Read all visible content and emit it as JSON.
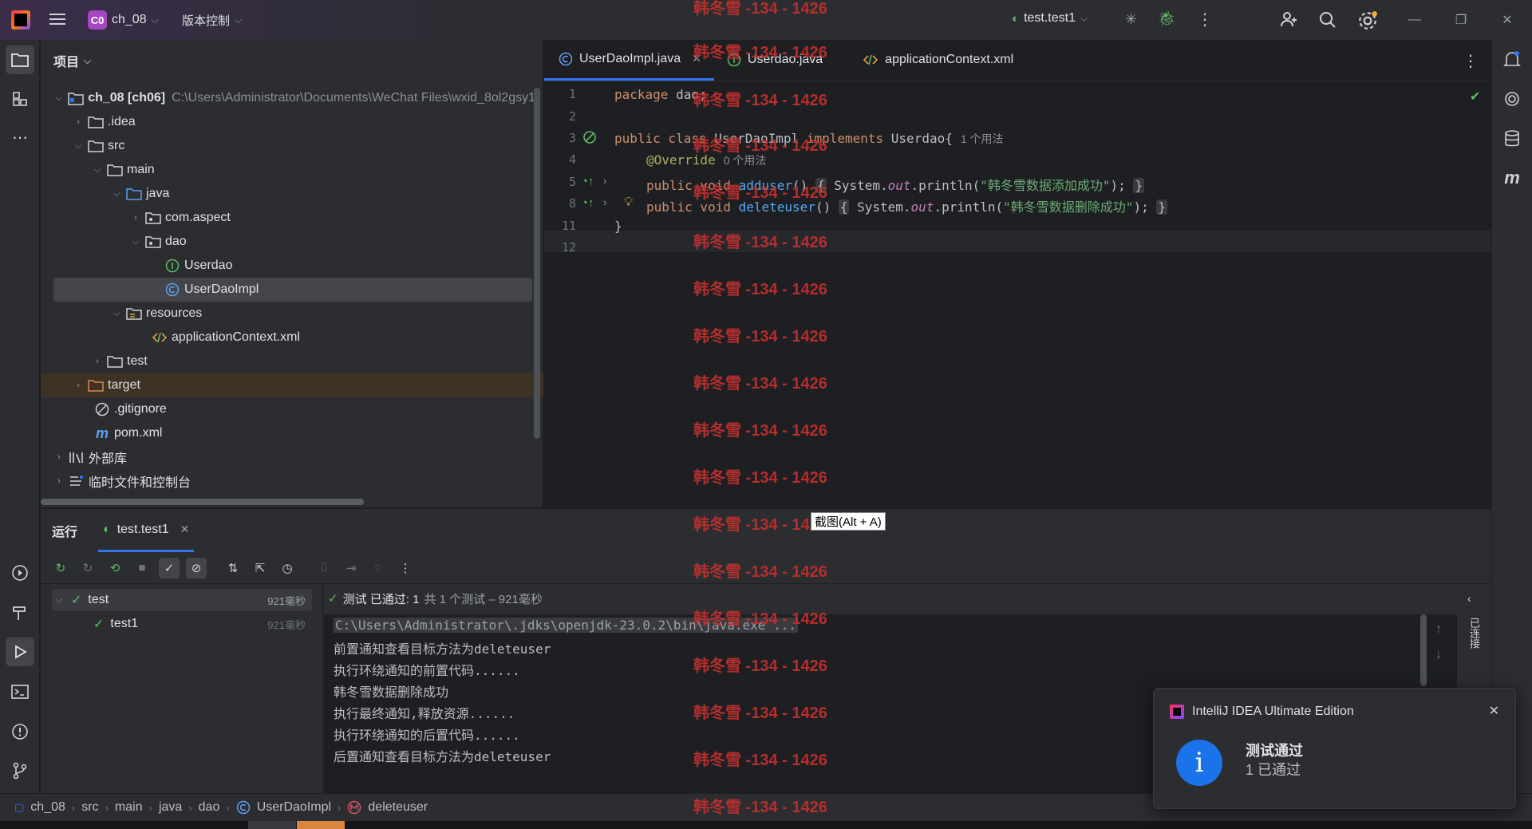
{
  "titlebar": {
    "project_badge": "C0",
    "project_name": "ch_08",
    "vcs_label": "版本控制",
    "run_config": "test.test1"
  },
  "project_panel": {
    "title": "项目",
    "tree": [
      {
        "label": "ch_08 [ch06]",
        "extra": "C:\\Users\\Administrator\\Documents\\WeChat Files\\wxid_8ol2gsy1"
      },
      {
        "label": ".idea"
      },
      {
        "label": "src"
      },
      {
        "label": "main"
      },
      {
        "label": "java"
      },
      {
        "label": "com.aspect"
      },
      {
        "label": "dao"
      },
      {
        "label": "Userdao"
      },
      {
        "label": "UserDaoImpl"
      },
      {
        "label": "resources"
      },
      {
        "label": "applicationContext.xml"
      },
      {
        "label": "test"
      },
      {
        "label": "target"
      },
      {
        "label": ".gitignore"
      },
      {
        "label": "pom.xml"
      },
      {
        "label": "外部库"
      },
      {
        "label": "临时文件和控制台"
      }
    ]
  },
  "editor": {
    "tabs": [
      {
        "label": "UserDaoImpl.java"
      },
      {
        "label": "Userdao.java"
      },
      {
        "label": "applicationContext.xml"
      }
    ],
    "line_numbers": [
      "1",
      "2",
      "3",
      "4",
      "5",
      "8",
      "11",
      "12"
    ],
    "code": {
      "l1_kw": "package",
      "l1_rest": " dao;",
      "l3_kw1": "public class",
      "l3_name": " UserDaoImpl ",
      "l3_kw2": "implements",
      "l3_rest": " Userdao{",
      "l3_hint": "1 个用法",
      "l4_ann": "@Override",
      "l4_hint": "0 个用法",
      "l5_kw": "public void",
      "l5_fn": " adduser",
      "l5_a": "() ",
      "l5_b": "{",
      "l5_c": " System.",
      "l5_out": "out",
      "l5_d": ".println(",
      "l5_str": "\"韩冬雪数据添加成功\"",
      "l5_e": "); ",
      "l5_f": "}",
      "l8_kw": "public void",
      "l8_fn": " deleteuser",
      "l8_a": "() ",
      "l8_b": "{",
      "l8_c": " System.",
      "l8_out": "out",
      "l8_d": ".println(",
      "l8_str": "\"韩冬雪数据删除成功\"",
      "l8_e": "); ",
      "l8_f": "}",
      "l11": "}"
    }
  },
  "run_panel": {
    "tab_run": "运行",
    "tab_config": "test.test1",
    "tests": [
      {
        "name": "test",
        "time": "921毫秒"
      },
      {
        "name": "test1",
        "time": "921毫秒"
      }
    ],
    "summary_status": "测试 已通过: 1",
    "summary_detail": "共 1 个测试 – 921毫秒",
    "console": [
      "C:\\Users\\Administrator\\.jdks\\openjdk-23.0.2\\bin\\java.exe ...",
      "前置通知查看目标方法为deleteuser",
      "执行环绕通知的前置代码......",
      "韩冬雪数据删除成功",
      "执行最终通知,释放资源......",
      "执行环绕通知的后置代码......",
      "后置通知查看目标方法为deleteuser"
    ],
    "side_label": "已连接"
  },
  "notification": {
    "app": "IntelliJ IDEA Ultimate Edition",
    "title": "测试通过",
    "body": "1 已通过"
  },
  "tooltip": "截图(Alt + A)",
  "watermark": "韩冬雪 -134 - 1426",
  "statusbar": {
    "crumbs": [
      "ch_08",
      "src",
      "main",
      "java",
      "dao",
      "UserDaoImpl",
      "deleteuser"
    ]
  },
  "colors": {
    "accent": "#3574f0",
    "watermark": "#c0302e",
    "success": "#5fb865"
  }
}
